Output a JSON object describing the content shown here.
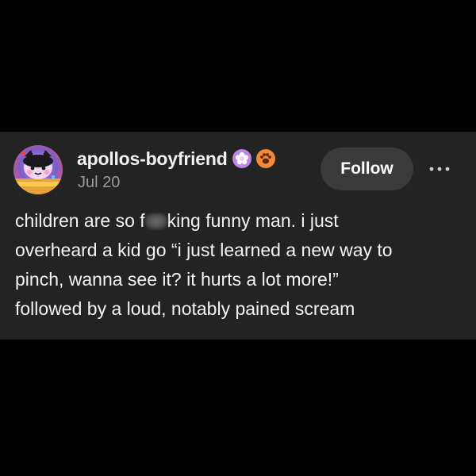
{
  "post": {
    "username": "apollos-boyfriend",
    "date": "Jul 20",
    "follow_label": "Follow",
    "more_icon": "more-horizontal-icon",
    "badges": [
      "purple-flower-badge-icon",
      "orange-paw-badge-icon"
    ],
    "body": {
      "line1_before": "children are so f",
      "line1_after": "king funny man. i just",
      "line2": "overheard a kid go “i just learned a new way to",
      "line3": "pinch, wanna see it? it hurts a lot more!”",
      "line4": "followed by a loud, notably pained scream"
    }
  },
  "colors": {
    "background": "#000000",
    "card": "#232323",
    "follow_button": "#3a3a3a",
    "date_text": "#9a9a9a"
  }
}
